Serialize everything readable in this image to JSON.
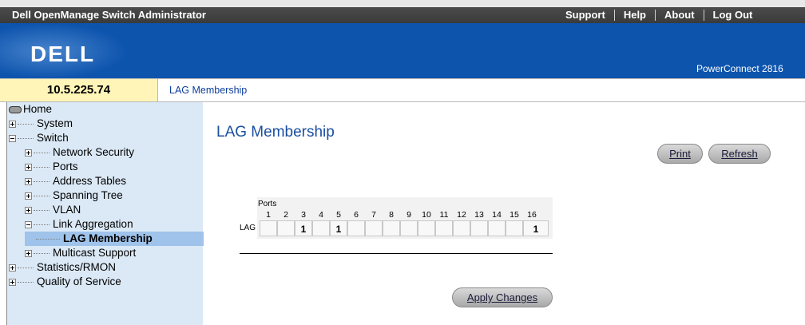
{
  "app_title": "Dell OpenManage Switch Administrator",
  "top_links": [
    "Support",
    "Help",
    "About",
    "Log Out"
  ],
  "header": {
    "logo": "DELL",
    "model": "PowerConnect 2816"
  },
  "strip": {
    "ip": "10.5.225.74",
    "breadcrumb": "LAG Membership"
  },
  "tree": {
    "home": "Home",
    "system": "System",
    "switch": "Switch",
    "network_security": "Network Security",
    "ports": "Ports",
    "address_tables": "Address Tables",
    "spanning_tree": "Spanning Tree",
    "vlan": "VLAN",
    "link_aggregation": "Link Aggregation",
    "lag_membership": "LAG Membership",
    "multicast_support": "Multicast Support",
    "statistics_rmon": "Statistics/RMON",
    "quality_of_service": "Quality of Service"
  },
  "main": {
    "title": "LAG Membership",
    "print_label": "Print",
    "refresh_label": "Refresh",
    "apply_label": "Apply Changes",
    "ports_label": "Ports",
    "lag_label": "LAG",
    "port_numbers": [
      "1",
      "2",
      "3",
      "4",
      "5",
      "6",
      "7",
      "8",
      "9",
      "10",
      "11",
      "12",
      "13",
      "14",
      "15",
      "16"
    ],
    "lag_values": [
      "",
      "",
      "1",
      "",
      "1",
      "",
      "",
      "",
      "",
      "",
      "",
      "",
      "",
      "",
      "",
      "1"
    ]
  }
}
